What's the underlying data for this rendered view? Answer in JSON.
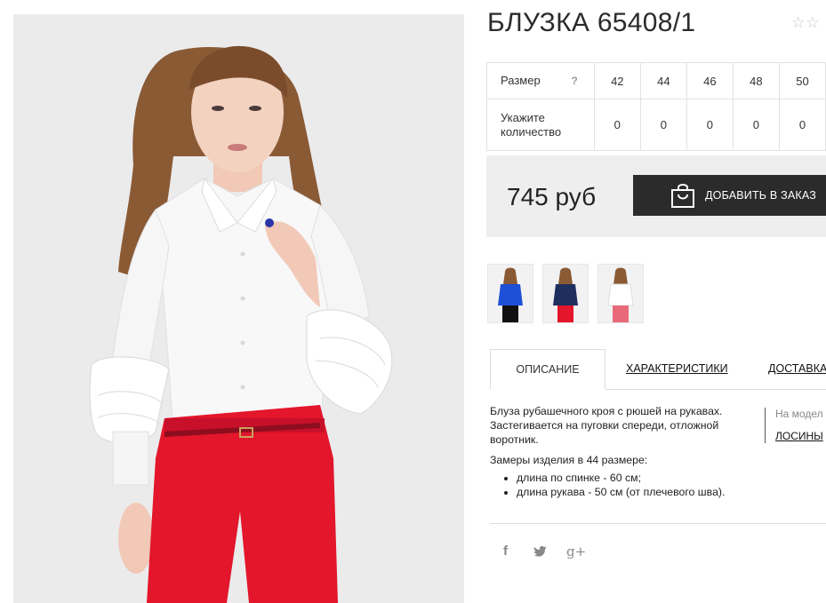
{
  "product": {
    "title": "БЛУЗКА 65408/1",
    "rating_stars": "☆☆"
  },
  "sizes": {
    "size_label": "Размер",
    "help_label": "?",
    "qty_label": "Укажите количество",
    "values": [
      "42",
      "44",
      "46",
      "48",
      "50"
    ],
    "quantities": [
      "0",
      "0",
      "0",
      "0",
      "0"
    ]
  },
  "purchase": {
    "price": "745 руб",
    "add_button_label": "ДОБАВИТЬ В ЗАКАЗ"
  },
  "thumbnails": [
    {
      "name": "blue-blouse",
      "color": "#1f4fd6"
    },
    {
      "name": "navy-blouse",
      "color": "#1e2f5e"
    },
    {
      "name": "white-blouse",
      "color": "#f4f4f4"
    }
  ],
  "tabs": {
    "description": "ОПИСАНИЕ",
    "characteristics": "ХАРАКТЕРИСТИКИ",
    "delivery": "ДОСТАВКА"
  },
  "description": {
    "text": "Блуза рубашечного кроя с рюшей на рукавах. Застегивается на пуговки спереди, отложной воротник.",
    "measure_intro": "Замеры изделия в 44 размере:",
    "measures": [
      "длина по спинке - 60 см;",
      "длина рукава - 50 см (от плечевого шва)."
    ]
  },
  "model_note": {
    "on_model": "На модел",
    "pants_link": "ЛОСИНЫ"
  },
  "social": {
    "facebook": "f",
    "twitter": "🐦",
    "google_plus": "g+"
  },
  "colors": {
    "dark_button": "#2b2b2b",
    "price_bg": "#eeeeee",
    "pants_red": "#e3162b"
  }
}
